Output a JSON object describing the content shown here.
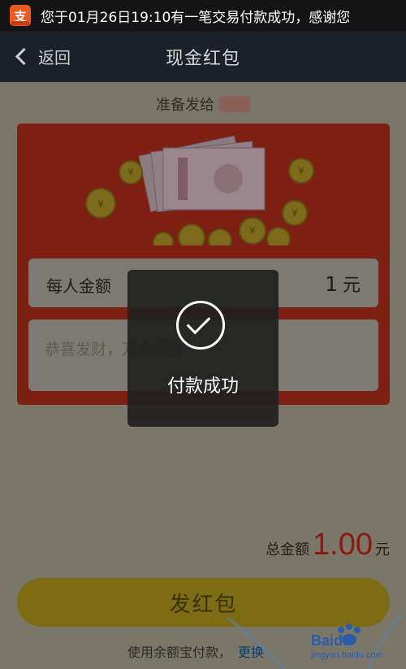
{
  "status_bar": {
    "app_icon_glyph": "支",
    "notification": "您于01月26日19:10有一笔交易付款成功，感谢您"
  },
  "nav": {
    "back_label": "返回",
    "title": "现金红包"
  },
  "recipient": {
    "prefix": "准备发给"
  },
  "form": {
    "amount_label": "每人金额",
    "amount_value": "1",
    "amount_unit": "元",
    "greeting_placeholder": "恭喜发财，万事如意"
  },
  "total": {
    "label": "总金额",
    "value": "1.00",
    "unit": "元"
  },
  "send_button": "发红包",
  "payment": {
    "method_text": "使用余额宝付款，",
    "change_link": "更换"
  },
  "toast": {
    "message": "付款成功",
    "icon": "check-circle-icon"
  },
  "watermark": {
    "brand": "Baidu",
    "url": "jingyan.baidu.com"
  },
  "colors": {
    "status_bar": "#141414",
    "nav_bar": "#1c2029",
    "card_red": "#7e1f14",
    "button_gold": "#7d6c13",
    "total_red": "#8a1a10",
    "toast_bg": "#202020"
  }
}
